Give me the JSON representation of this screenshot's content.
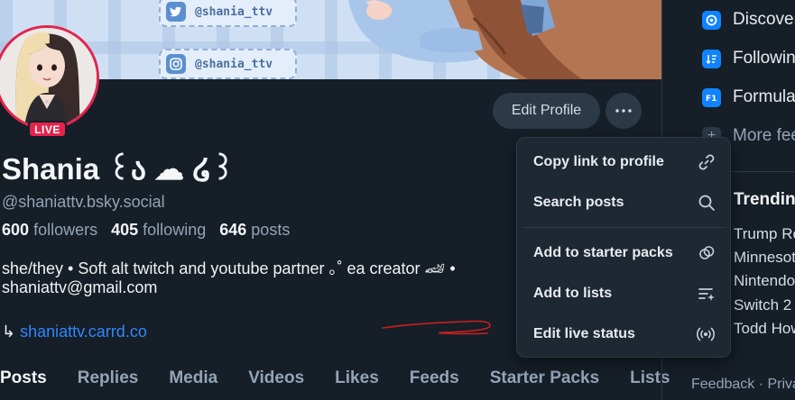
{
  "banner": {
    "twitter_handle": "@shania_ttv",
    "instagram_handle": "@shania_ttv"
  },
  "profile": {
    "live_label": "LIVE",
    "display_name": "Shania ꒰ა ☁︎ ໒꒱",
    "handle": "@shaniattv.bsky.social",
    "followers_count": "600",
    "followers_label": "followers",
    "following_count": "405",
    "following_label": "following",
    "posts_count": "646",
    "posts_label": "posts",
    "bio_line1": "she/they • Soft alt twitch and youtube partner ｡˚ ea creator 🏎 •",
    "bio_line2": "shaniattv@gmail.com",
    "link_arrow": "↳ ",
    "link_text": "shaniattv.carrd.co"
  },
  "actions": {
    "edit_profile": "Edit Profile"
  },
  "tabs": [
    "Posts",
    "Replies",
    "Media",
    "Videos",
    "Likes",
    "Feeds",
    "Starter Packs",
    "Lists"
  ],
  "menu": {
    "copy_link": "Copy link to profile",
    "search_posts": "Search posts",
    "add_starter_packs": "Add to starter packs",
    "add_lists": "Add to lists",
    "edit_live_status": "Edit live status"
  },
  "sidebar": {
    "feeds": {
      "discover": "Discover",
      "following": "Following",
      "formula": "Formula",
      "more": "More feeds"
    },
    "trending_title": "Trending",
    "trends": [
      "Trump Re",
      "Minnesota",
      "Nintendo",
      "Switch 2",
      "Todd How"
    ],
    "footer": "Feedback · Privacy"
  },
  "colors": {
    "background": "#161e27",
    "accent_blue": "#1083fe",
    "live_red": "#e4234c",
    "muted_text": "#93a4b7"
  },
  "icons": {
    "more": "ellipsis-icon",
    "copy_link": "link-icon",
    "search": "magnifier-icon",
    "starter_pack": "starter-pack-icon",
    "lists": "list-sparkle-icon",
    "live": "broadcast-icon"
  }
}
